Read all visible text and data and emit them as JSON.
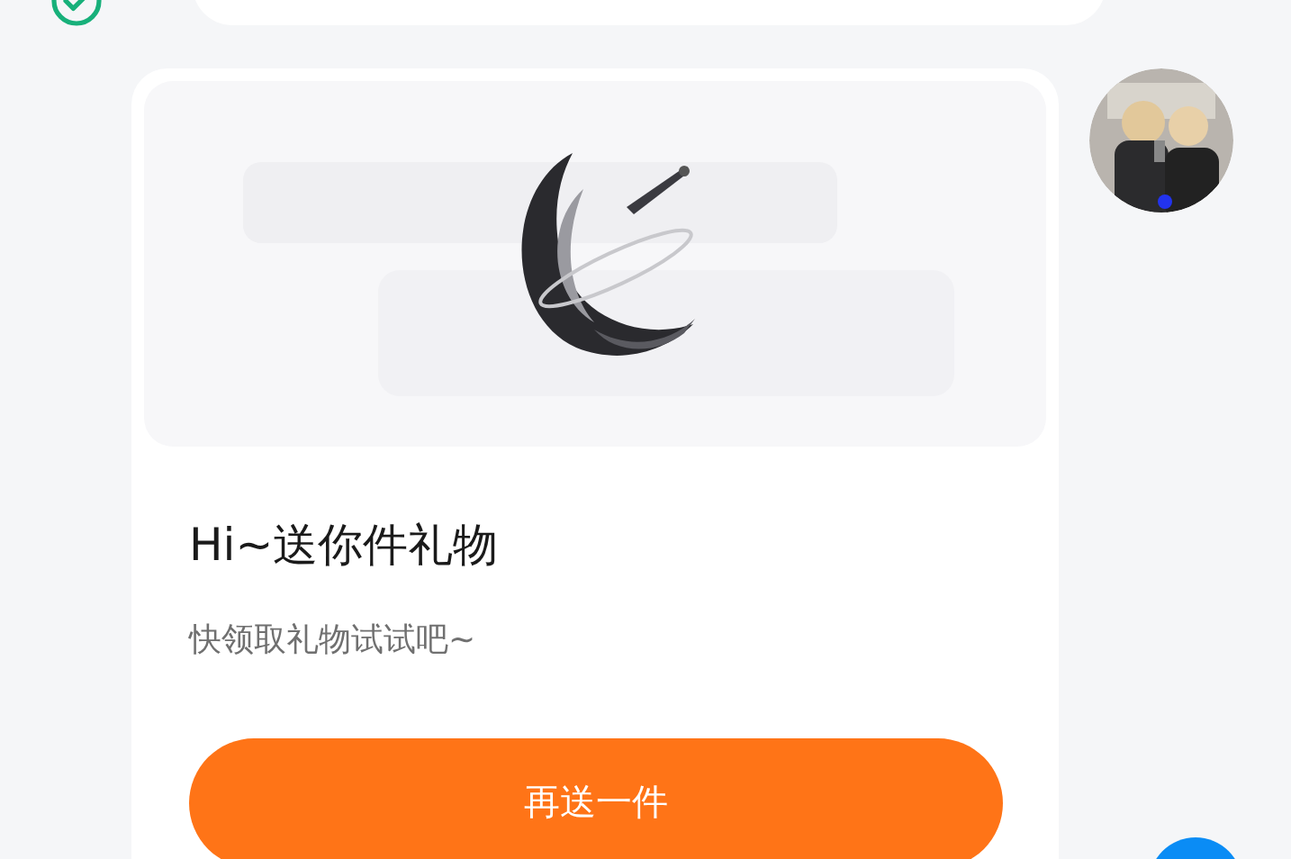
{
  "gift_message": {
    "title": "Hi~送你件礼物",
    "subtitle": "快领取礼物试试吧~",
    "button": "再送一件"
  }
}
